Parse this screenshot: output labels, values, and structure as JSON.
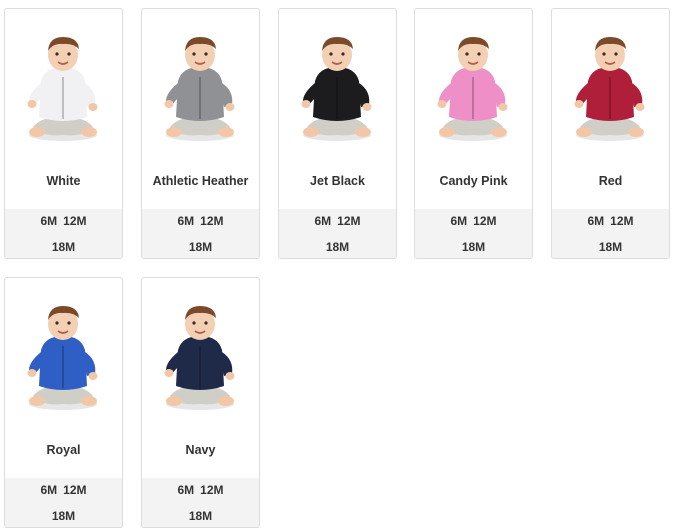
{
  "colors": [
    {
      "name": "White",
      "hex": "#f1f1f3",
      "sizes_row1": [
        "6M",
        "12M"
      ],
      "sizes_row2": [
        "18M"
      ]
    },
    {
      "name": "Athletic Heather",
      "hex": "#8f9194",
      "sizes_row1": [
        "6M",
        "12M"
      ],
      "sizes_row2": [
        "18M"
      ]
    },
    {
      "name": "Jet Black",
      "hex": "#1c1c1f",
      "sizes_row1": [
        "6M",
        "12M"
      ],
      "sizes_row2": [
        "18M"
      ]
    },
    {
      "name": "Candy Pink",
      "hex": "#ee8fc8",
      "sizes_row1": [
        "6M",
        "12M"
      ],
      "sizes_row2": [
        "18M"
      ]
    },
    {
      "name": "Red",
      "hex": "#b01f3a",
      "sizes_row1": [
        "6M",
        "12M"
      ],
      "sizes_row2": [
        "18M"
      ]
    },
    {
      "name": "Royal",
      "hex": "#2f5fc4",
      "sizes_row1": [
        "6M",
        "12M"
      ],
      "sizes_row2": [
        "18M"
      ]
    },
    {
      "name": "Navy",
      "hex": "#1f2a49",
      "sizes_row1": [
        "6M",
        "12M"
      ],
      "sizes_row2": [
        "18M"
      ]
    }
  ]
}
